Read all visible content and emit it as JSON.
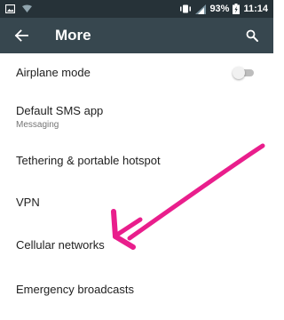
{
  "status_bar": {
    "battery_percent": "93%",
    "time": "11:14",
    "icons": [
      "image-notification-icon",
      "signal-notification-icon",
      "vibrate-icon",
      "cell-signal-icon",
      "battery-icon"
    ]
  },
  "toolbar": {
    "title": "More",
    "back_icon": "arrow-back-icon",
    "search_icon": "search-icon"
  },
  "items": [
    {
      "title": "Airplane mode",
      "toggle_state": "off"
    },
    {
      "title": "Default SMS app",
      "subtitle": "Messaging"
    },
    {
      "title": "Tethering & portable hotspot"
    },
    {
      "title": "VPN"
    },
    {
      "title": "Cellular networks"
    },
    {
      "title": "Emergency broadcasts"
    }
  ],
  "colors": {
    "status_bar": "#263238",
    "toolbar": "#37474f",
    "annotation_arrow": "#e91e8c"
  }
}
